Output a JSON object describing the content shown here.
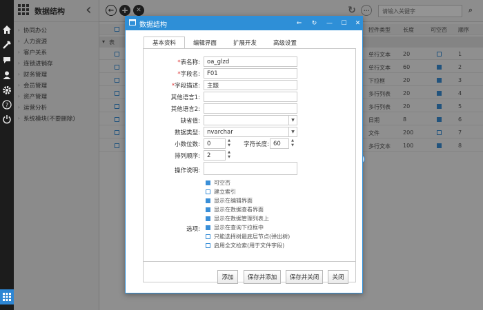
{
  "sidebar": {
    "title": "数据结构",
    "items": [
      {
        "label": "协同办公"
      },
      {
        "label": "人力资源"
      },
      {
        "label": "客户关系"
      },
      {
        "label": "连锁进销存"
      },
      {
        "label": "财务管理"
      },
      {
        "label": "会员管理"
      },
      {
        "label": "资产管理"
      },
      {
        "label": "运营分析"
      },
      {
        "label": "系统模块(不要删除)"
      }
    ]
  },
  "toolbar": {
    "search_placeholder": "请输入关键字"
  },
  "grid": {
    "columns": [
      "控件类型",
      "长度",
      "可空否",
      "顺序"
    ],
    "group_label": "表",
    "rows": [
      {
        "type": "单行文本",
        "length": "20",
        "nullable": false,
        "order": "1"
      },
      {
        "type": "单行文本",
        "length": "60",
        "nullable": true,
        "order": "2"
      },
      {
        "type": "下拉框",
        "length": "20",
        "nullable": true,
        "order": "3"
      },
      {
        "type": "多行列表",
        "length": "20",
        "nullable": true,
        "order": "4"
      },
      {
        "type": "多行列表",
        "length": "20",
        "nullable": true,
        "order": "5"
      },
      {
        "type": "日期",
        "length": "8",
        "nullable": true,
        "order": "6"
      },
      {
        "type": "文件",
        "length": "200",
        "nullable": false,
        "order": "7"
      },
      {
        "type": "多行文本",
        "length": "100",
        "nullable": true,
        "order": "8"
      }
    ]
  },
  "dialog": {
    "title": "数据结构",
    "tabs": [
      "基本资料",
      "编辑界面",
      "扩展开发",
      "高级设置"
    ],
    "active_tab": 0,
    "fields": {
      "table_name": {
        "label": "表名称:",
        "value": "oa_glzd",
        "required": true
      },
      "field_name": {
        "label": "字段名:",
        "value": "F01",
        "required": true
      },
      "field_desc": {
        "label": "字段描述:",
        "value": "主题",
        "required": true
      },
      "other_lang1": {
        "label": "其他语言1:",
        "value": ""
      },
      "other_lang2": {
        "label": "其他语言2:",
        "value": ""
      },
      "default_value": {
        "label": "缺省值:",
        "value": ""
      },
      "data_type": {
        "label": "数据类型:",
        "value": "nvarchar"
      },
      "decimals": {
        "label": "小数位数:",
        "value": "0"
      },
      "char_length": {
        "label": "字符长度:",
        "value": "60"
      },
      "sort_order": {
        "label": "排列顺序:",
        "value": "2"
      },
      "instructions": {
        "label": "操作说明:",
        "value": ""
      }
    },
    "options_label": "选项:",
    "options": [
      {
        "label": "可空否",
        "checked": true
      },
      {
        "label": "建立索引",
        "checked": false
      },
      {
        "label": "显示在编辑界面",
        "checked": true
      },
      {
        "label": "显示在数据查看界面",
        "checked": true
      },
      {
        "label": "显示在数据管理列表上",
        "checked": true
      },
      {
        "label": "显示在查询下拉框中",
        "checked": true
      },
      {
        "label": "只能选择树最底层节点(弹出树)",
        "checked": false
      },
      {
        "label": "启用全文检索(用于文件字段)",
        "checked": false
      }
    ],
    "buttons": {
      "add": "添加",
      "save_add": "保存并添加",
      "save_close": "保存并关闭",
      "close": "关闭"
    }
  },
  "colors": {
    "accent": "#2e8fd7",
    "rail": "#1c1c1c"
  }
}
